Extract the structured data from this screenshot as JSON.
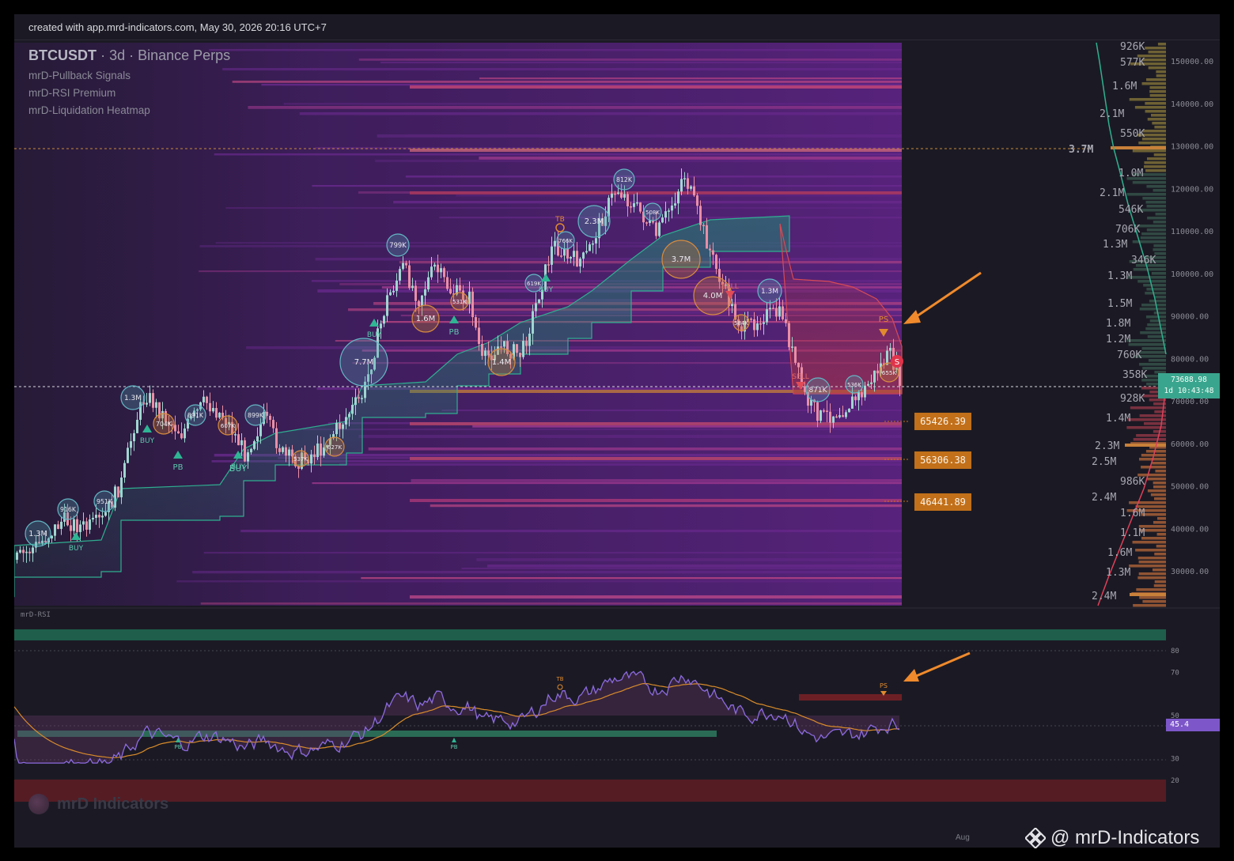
{
  "topbar": {
    "created_text": "created with app.mrd-indicators.com, May 30, 2026 20:16 UTC+7"
  },
  "legend": {
    "symbol": "BTCUSDT",
    "timeframe_exchange": "· 3d · Binance Perps",
    "indicators": [
      "mrD-Pullback Signals",
      "mrD-RSI Premium",
      "mrD-Liquidation Heatmap"
    ]
  },
  "price_axis": {
    "ticks": [
      "150000.00",
      "140000.00",
      "130000.00",
      "120000.00",
      "110000.00",
      "100000.00",
      "90000.00",
      "80000.00",
      "70000.00",
      "60000.00",
      "50000.00",
      "40000.00",
      "30000.00"
    ],
    "last_price": "73688.98",
    "countdown": "1d 10:43:48"
  },
  "resistance_line": {
    "label": "3.7M"
  },
  "liquidation_levels": [
    "65426.39",
    "56306.38",
    "46441.89"
  ],
  "volume_profile": {
    "labels": [
      "926K",
      "577K",
      "1.6M",
      "2.1M",
      "550K",
      "3.7M",
      "1.0M",
      "2.1M",
      "546K",
      "706K",
      "1.3M",
      "346K",
      "1.3M",
      "1.5M",
      "1.8M",
      "1.2M",
      "760K",
      "358K",
      "928K",
      "1.4M",
      "2.3M",
      "2.5M",
      "986K",
      "2.4M",
      "1.6M",
      "1.1M",
      "1.6M",
      "1.3M",
      "2.4M"
    ]
  },
  "chart_bubbles": {
    "liq_bubbles": [
      "1.3M",
      "916K",
      "951K",
      "1.3M",
      "704K",
      "891K",
      "607K",
      "899K",
      "537K",
      "627K",
      "7.7M",
      "799K",
      "1.6M",
      "531K",
      "1.4M",
      "619K",
      "766K",
      "2.3M",
      "812K",
      "508K",
      "3.7M",
      "4.0M",
      "584K",
      "1.3M",
      "871K",
      "536K",
      "655K"
    ]
  },
  "signals": {
    "buy": "BUY",
    "pb": "PB",
    "sell": "SELL",
    "tb": "TB",
    "ps": "PS",
    "s": "S"
  },
  "rsi": {
    "title": "mrD-RSI",
    "levels": [
      "80",
      "70",
      "50",
      "30",
      "20"
    ],
    "current": "45.4",
    "markers": {
      "pb": "PB",
      "tb": "TB",
      "ps": "PS"
    }
  },
  "time_axis": {
    "aug": "Aug"
  },
  "watermark": {
    "text": "mrD Indicators"
  },
  "credit": {
    "text": "@ mrD-Indicators"
  },
  "colors": {
    "bg": "#1b1a24",
    "bull": "#9fd6d0",
    "bear": "#e98ea6",
    "support_band": "#1f8a73",
    "resistance_band": "#b0343f",
    "liq_tag": "#c2701a",
    "rsi_line": "#8d6be0",
    "rsi_ma": "#d98b2a",
    "accent_arrow": "#f08a2c"
  }
}
